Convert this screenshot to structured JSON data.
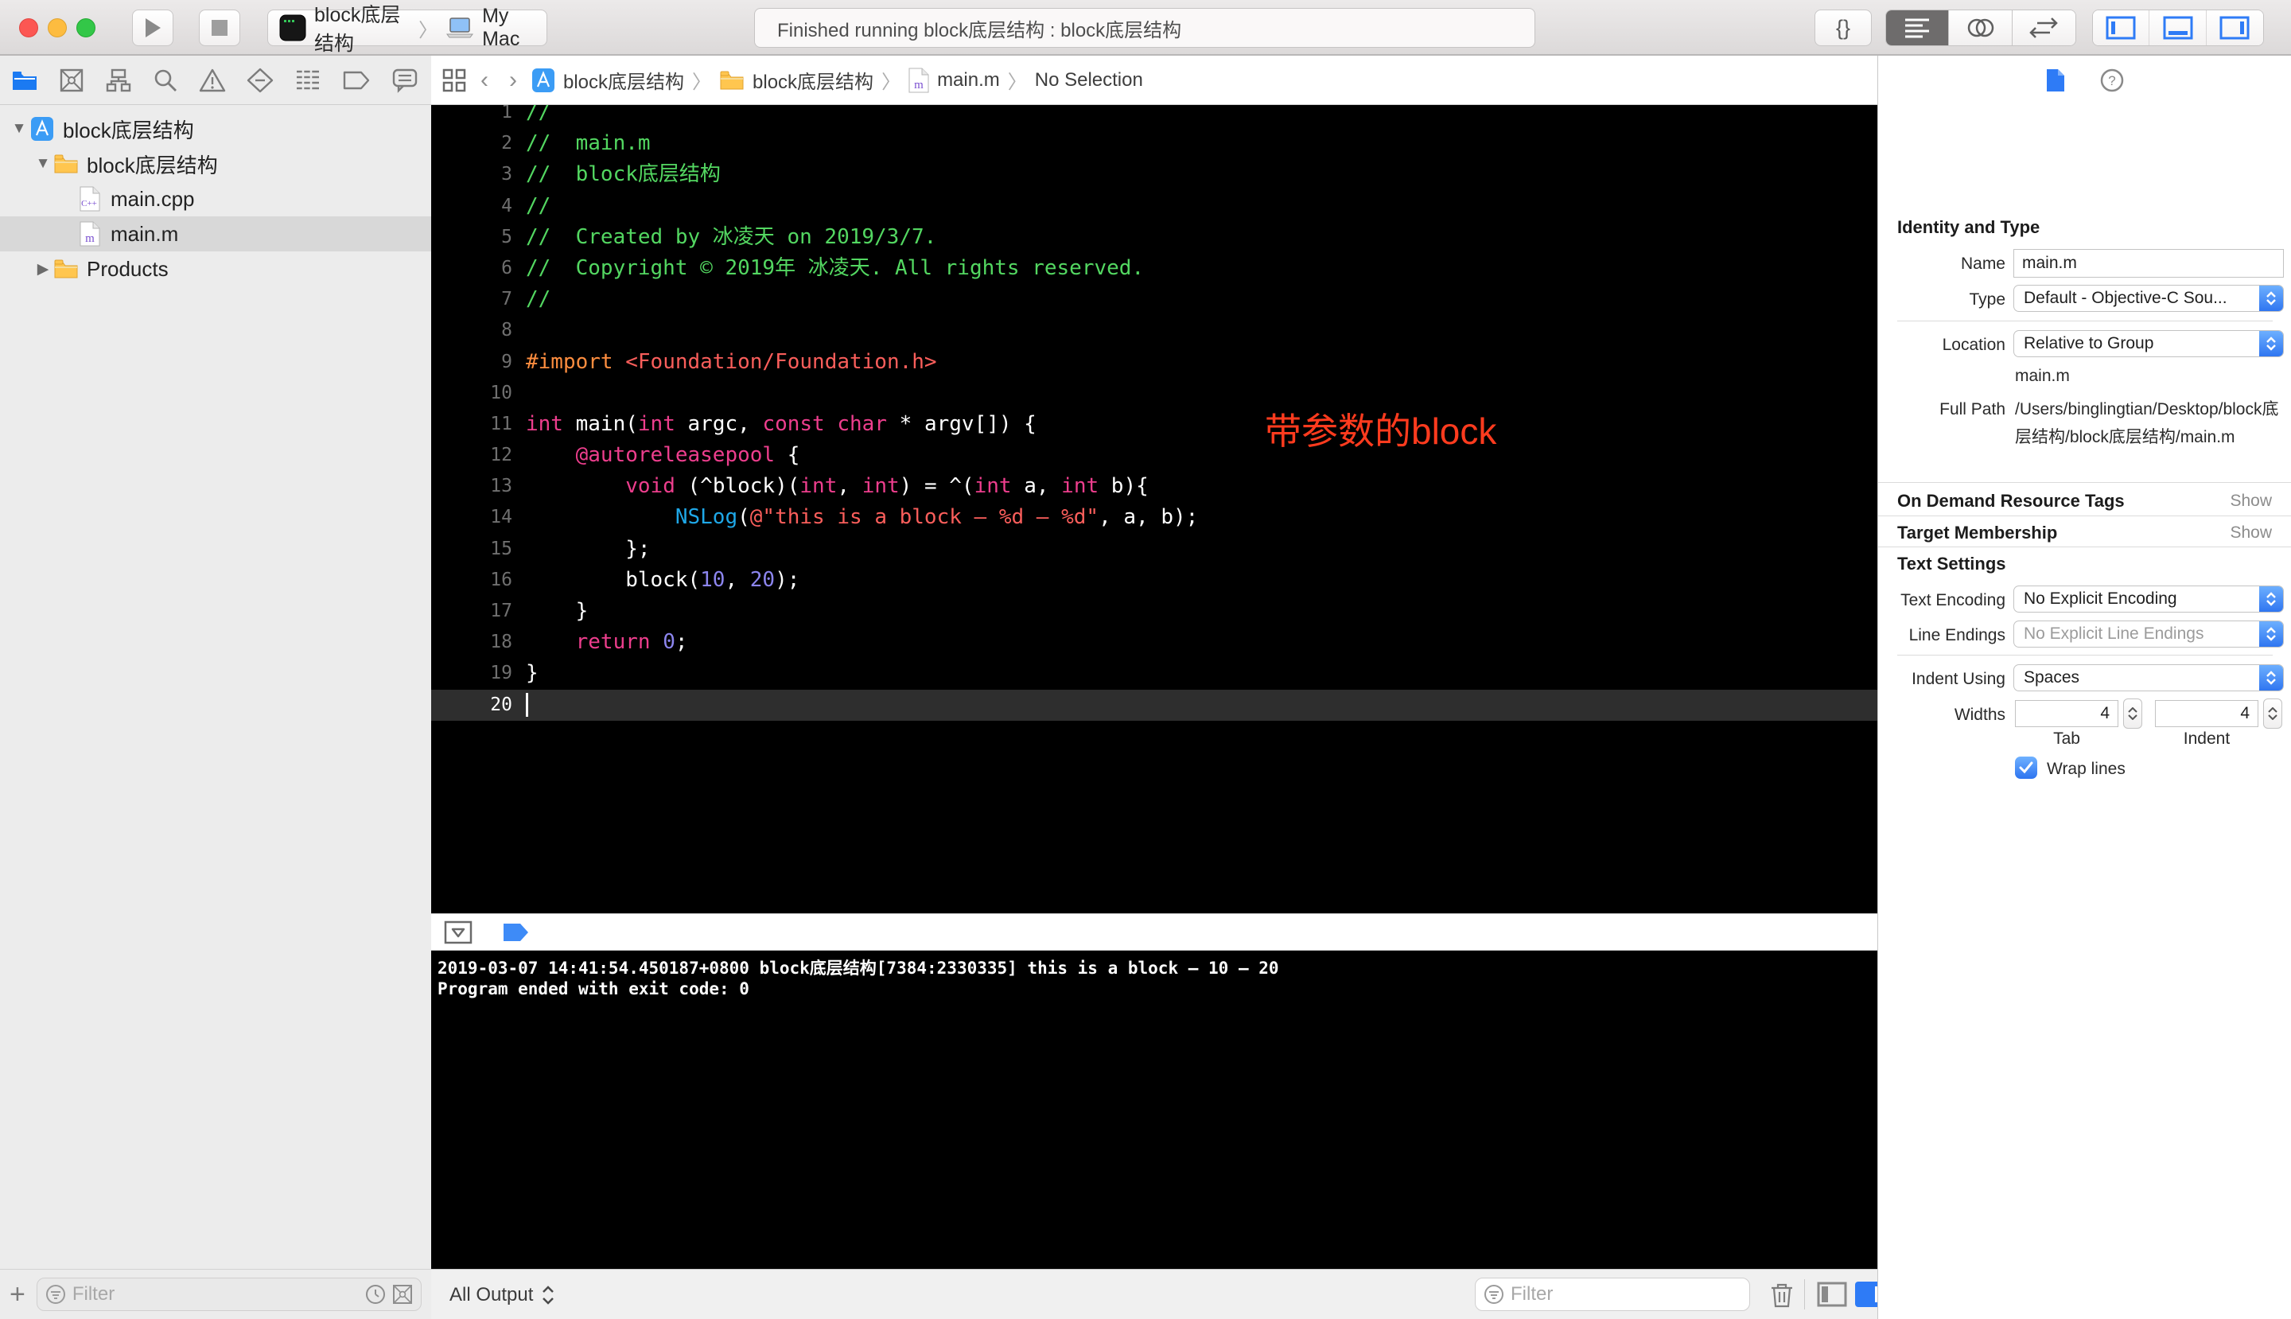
{
  "colors": {
    "accent": "#2E7BF6",
    "annotation_red": "#FF3B1E",
    "traffic": [
      "#FC5753",
      "#FDBC40",
      "#33C748"
    ],
    "syntax": {
      "comment": "#53D761",
      "keyword": "#ED3E8D",
      "string": "#FA5E5B",
      "preproc": "#FD8D3F",
      "func": "#1FA8E8",
      "number": "#8C85EE",
      "plain": "#FFFFFF"
    }
  },
  "toolbar": {
    "scheme": {
      "target": "block底层结构",
      "destination": "My Mac"
    },
    "status": "Finished running block底层结构 : block底层结构",
    "library_label": "{}"
  },
  "navigator_icons": [
    {
      "name": "project-navigator-icon",
      "active": true
    },
    {
      "name": "source-control-icon"
    },
    {
      "name": "symbol-navigator-icon"
    },
    {
      "name": "find-navigator-icon"
    },
    {
      "name": "issue-navigator-icon"
    },
    {
      "name": "test-navigator-icon"
    },
    {
      "name": "debug-navigator-icon"
    },
    {
      "name": "breakpoint-navigator-icon"
    },
    {
      "name": "report-navigator-icon"
    }
  ],
  "jump_bar": {
    "back": "‹",
    "forward": "›",
    "crumbs": [
      {
        "icon": "app",
        "label": "block底层结构"
      },
      {
        "icon": "folder",
        "label": "block底层结构"
      },
      {
        "icon": "file-m",
        "label": "main.m"
      },
      {
        "icon": null,
        "label": "No Selection"
      }
    ]
  },
  "sidebar": {
    "filter_placeholder": "Filter",
    "items": [
      {
        "level": 0,
        "disclosure": "open",
        "icon": "app",
        "label": "block底层结构"
      },
      {
        "level": 1,
        "disclosure": "open",
        "icon": "folder",
        "label": "block底层结构"
      },
      {
        "level": 2,
        "disclosure": "none",
        "icon": "file-cpp",
        "label": "main.cpp"
      },
      {
        "level": 2,
        "disclosure": "none",
        "icon": "file-m",
        "label": "main.m",
        "selected": true
      },
      {
        "level": 1,
        "disclosure": "closed",
        "icon": "folder",
        "label": "Products"
      }
    ]
  },
  "editor": {
    "annotation": "带参数的block",
    "current_line": 20,
    "lines": [
      {
        "n": 1,
        "tokens": [
          [
            "comment",
            "//"
          ]
        ]
      },
      {
        "n": 2,
        "tokens": [
          [
            "comment",
            "//  main.m"
          ]
        ]
      },
      {
        "n": 3,
        "tokens": [
          [
            "comment",
            "//  block底层结构"
          ]
        ]
      },
      {
        "n": 4,
        "tokens": [
          [
            "comment",
            "//"
          ]
        ]
      },
      {
        "n": 5,
        "tokens": [
          [
            "comment",
            "//  Created by 冰凌天 on 2019/3/7."
          ]
        ]
      },
      {
        "n": 6,
        "tokens": [
          [
            "comment",
            "//  Copyright © 2019年 冰凌天. All rights reserved."
          ]
        ]
      },
      {
        "n": 7,
        "tokens": [
          [
            "comment",
            "//"
          ]
        ]
      },
      {
        "n": 8,
        "tokens": []
      },
      {
        "n": 9,
        "tokens": [
          [
            "preproc",
            "#import"
          ],
          [
            "plain",
            " "
          ],
          [
            "string",
            "<Foundation/Foundation.h>"
          ]
        ]
      },
      {
        "n": 10,
        "tokens": []
      },
      {
        "n": 11,
        "tokens": [
          [
            "keyword",
            "int"
          ],
          [
            "plain",
            " main("
          ],
          [
            "keyword",
            "int"
          ],
          [
            "plain",
            " argc, "
          ],
          [
            "keyword",
            "const"
          ],
          [
            "plain",
            " "
          ],
          [
            "keyword",
            "char"
          ],
          [
            "plain",
            " * argv[]) {"
          ]
        ]
      },
      {
        "n": 12,
        "tokens": [
          [
            "plain",
            "    "
          ],
          [
            "keyword",
            "@autoreleasepool"
          ],
          [
            "plain",
            " {"
          ]
        ]
      },
      {
        "n": 13,
        "tokens": [
          [
            "plain",
            "        "
          ],
          [
            "keyword",
            "void"
          ],
          [
            "plain",
            " (^block)("
          ],
          [
            "keyword",
            "int"
          ],
          [
            "plain",
            ", "
          ],
          [
            "keyword",
            "int"
          ],
          [
            "plain",
            ") = ^("
          ],
          [
            "keyword",
            "int"
          ],
          [
            "plain",
            " a, "
          ],
          [
            "keyword",
            "int"
          ],
          [
            "plain",
            " b){"
          ]
        ]
      },
      {
        "n": 14,
        "tokens": [
          [
            "plain",
            "            "
          ],
          [
            "func",
            "NSLog"
          ],
          [
            "plain",
            "("
          ],
          [
            "string",
            "@\"this is a block – %d – %d\""
          ],
          [
            "plain",
            ", a, b);"
          ]
        ]
      },
      {
        "n": 15,
        "tokens": [
          [
            "plain",
            "        };"
          ]
        ]
      },
      {
        "n": 16,
        "tokens": [
          [
            "plain",
            "        block("
          ],
          [
            "number",
            "10"
          ],
          [
            "plain",
            ", "
          ],
          [
            "number",
            "20"
          ],
          [
            "plain",
            ");"
          ]
        ]
      },
      {
        "n": 17,
        "tokens": [
          [
            "plain",
            "    }"
          ]
        ]
      },
      {
        "n": 18,
        "tokens": [
          [
            "plain",
            "    "
          ],
          [
            "keyword",
            "return"
          ],
          [
            "plain",
            " "
          ],
          [
            "number",
            "0"
          ],
          [
            "plain",
            ";"
          ]
        ]
      },
      {
        "n": 19,
        "tokens": [
          [
            "plain",
            "}"
          ]
        ]
      },
      {
        "n": 20,
        "tokens": []
      }
    ]
  },
  "debug_console": {
    "lines": [
      "2019-03-07 14:41:54.450187+0800 block底层结构[7384:2330335] this is a block – 10 – 20",
      "Program ended with exit code: 0"
    ],
    "all_output": "All Output",
    "filter_placeholder": "Filter"
  },
  "inspector": {
    "identity": {
      "header": "Identity and Type",
      "name_label": "Name",
      "name_value": "main.m",
      "type_label": "Type",
      "type_value": "Default - Objective-C Sou...",
      "location_label": "Location",
      "location_value": "Relative to Group",
      "location_file": "main.m",
      "full_path_label": "Full Path",
      "full_path": "/Users/binglingtian/Desktop/block底层结构/block底层结构/main.m"
    },
    "sections": [
      {
        "title": "On Demand Resource Tags",
        "action": "Show"
      },
      {
        "title": "Target Membership",
        "action": "Show"
      }
    ],
    "text_settings": {
      "header": "Text Settings",
      "encoding_label": "Text Encoding",
      "encoding_value": "No Explicit Encoding",
      "line_endings_label": "Line Endings",
      "line_endings_value": "No Explicit Line Endings",
      "indent_label": "Indent Using",
      "indent_value": "Spaces",
      "widths_label": "Widths",
      "tab_width": "4",
      "indent_width": "4",
      "tab_label": "Tab",
      "indent_sub_label": "Indent",
      "wrap_label": "Wrap lines",
      "wrap_checked": true
    }
  }
}
